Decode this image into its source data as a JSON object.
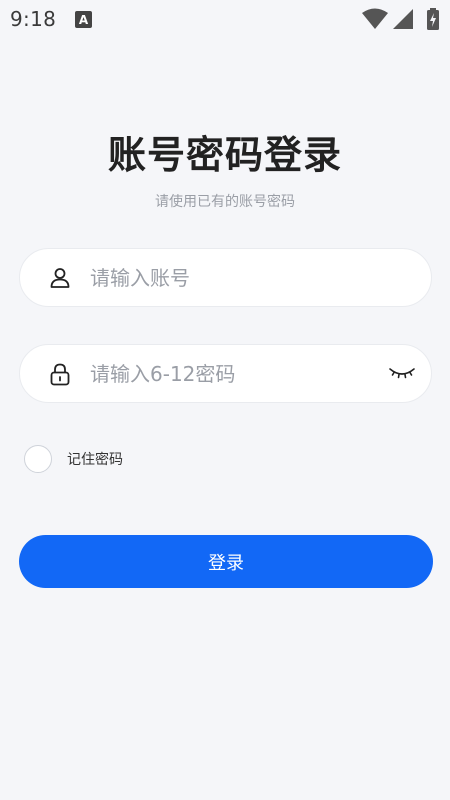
{
  "status_bar": {
    "time": "9:18",
    "notification_icon": "a-box-icon",
    "icons": [
      "wifi-icon",
      "signal-icon",
      "battery-charging-icon"
    ]
  },
  "login": {
    "title": "账号密码登录",
    "subtitle": "请使用已有的账号密码",
    "username": {
      "placeholder": "请输入账号",
      "value": "",
      "icon": "user-icon"
    },
    "password": {
      "placeholder": "请输入6-12密码",
      "value": "",
      "icon": "lock-icon",
      "toggle_icon": "eye-closed-icon"
    },
    "remember": {
      "label": "记住密码",
      "checked": false
    },
    "submit_label": "登录"
  },
  "colors": {
    "background": "#f5f6f9",
    "primary": "#1268f6",
    "placeholder": "#9a9ea6",
    "field_bg": "#ffffff"
  }
}
